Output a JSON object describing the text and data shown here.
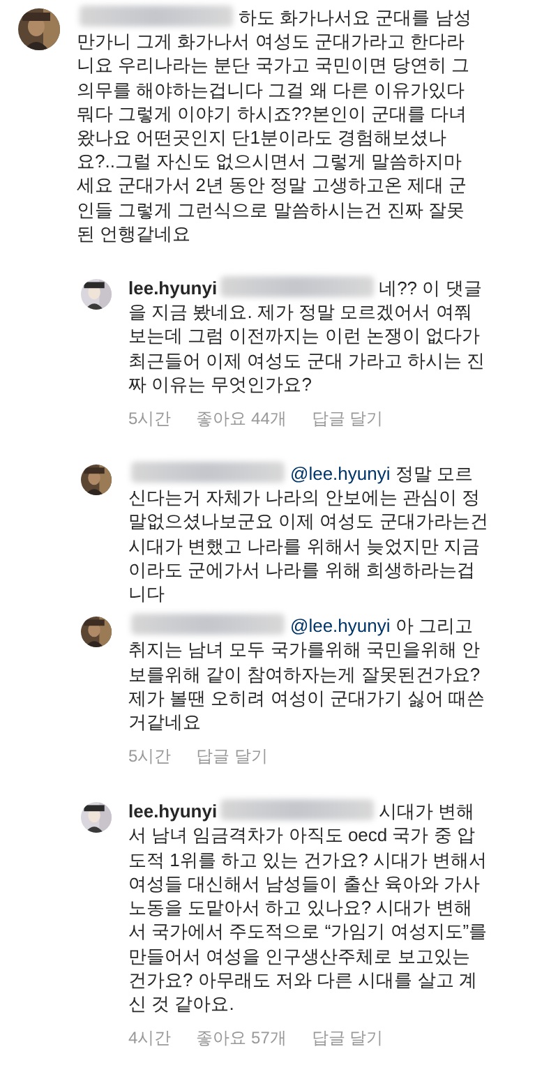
{
  "comments": [
    {
      "reply": false,
      "text": "하도 화가나서요 군대를 남성만가니 그게 화가나서 여성도 군대가라고 한다라니요 우리나라는 분단 국가고 국민이면 당연히 그 의무를 해야하는겁니다 그걸 왜 다른 이유가있다뭐다 그렇게 이야기 하시죠??본인이 군대를 다녀왔나요 어떤곳인지 단1분이라도 경험해보셨나요?..그럴 자신도 없으시면서 그렇게 말씀하지마세요 군대가서 2년 동안 정말 고생하고온 제대 군인들 그렇게 그런식으로 말씀하시는건 진짜 잘못된 언행같네요"
    },
    {
      "reply": true,
      "author": "lee.hyunyi",
      "text": "네?? 이 댓글을 지금 봤네요. 제가 정말 모르겠어서 여쭤보는데 그럼 이전까지는 이런 논쟁이 없다가 최근들어 이제 여성도 군대 가라고 하시는 진짜 이유는 무엇인가요?",
      "time": "5시간",
      "likes": "좋아요 44개",
      "reply_action": "답글 달기"
    },
    {
      "reply": true,
      "mention": "@lee.hyunyi",
      "text": "정말 모르신다는거 자체가 나라의 안보에는 관심이 정말없으셨나보군요 이제 여성도 군대가라는건 시대가 변했고 나라를 위해서 늦었지만 지금 이라도 군에가서 나라를 위해 희생하라는겁니다"
    },
    {
      "reply": true,
      "mention": "@lee.hyunyi",
      "text": "아 그리고 취지는 남녀 모두 국가를위해 국민을위해 안보를위해 같이 참여하자는게 잘못된건가요?제가 볼땐 오히려 여성이 군대가기 싫어 때쓴거같네요",
      "time": "5시간",
      "reply_action": "답글 달기"
    },
    {
      "reply": true,
      "author": "lee.hyunyi",
      "text": "시대가 변해서 남녀 임금격차가 아직도 oecd 국가 중 압도적 1위를 하고 있는 건가요? 시대가 변해서 여성들 대신해서 남성들이 출산 육아와 가사노동을 도맡아서 하고 있나요? 시대가 변해서 국가에서 주도적으로 “가임기 여성지도”를 만들어서 여성을 인구생산주체로 보고있는 건가요? 아무래도 저와 다른 시대를 살고 계신 것 같아요.",
      "time": "4시간",
      "likes": "좋아요 57개",
      "reply_action": "답글 달기"
    }
  ]
}
